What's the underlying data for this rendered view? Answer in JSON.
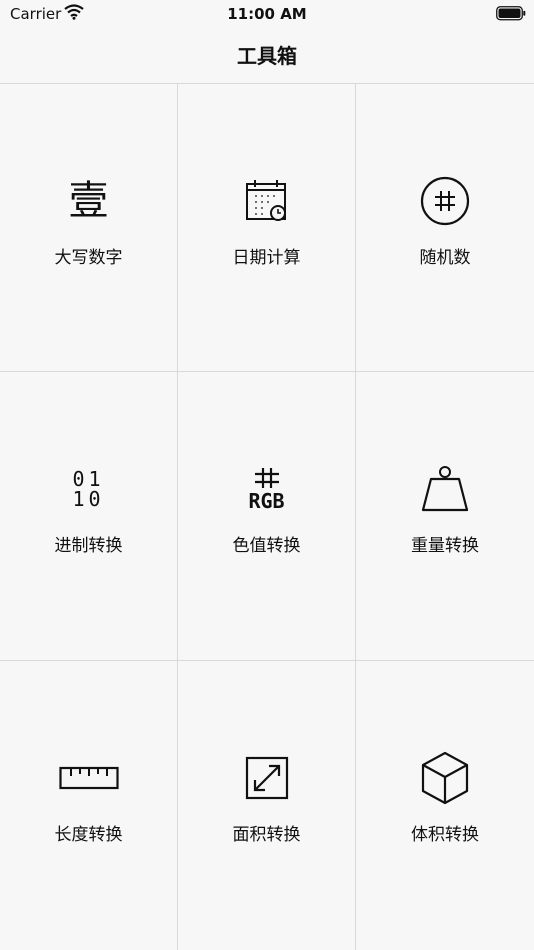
{
  "status_bar": {
    "carrier": "Carrier",
    "time": "11:00 AM"
  },
  "nav": {
    "title": "工具箱"
  },
  "tools": [
    {
      "label": "大写数字",
      "icon": "chinese-numeral-icon",
      "glyph": "壹"
    },
    {
      "label": "日期计算",
      "icon": "calendar-clock-icon"
    },
    {
      "label": "随机数",
      "icon": "hash-circle-icon"
    },
    {
      "label": "进制转换",
      "icon": "binary-icon",
      "glyph_line1": "01",
      "glyph_line2": "10"
    },
    {
      "label": "色值转换",
      "icon": "rgb-hash-icon",
      "glyph": "RGB"
    },
    {
      "label": "重量转换",
      "icon": "weight-icon"
    },
    {
      "label": "长度转换",
      "icon": "ruler-icon"
    },
    {
      "label": "面积转换",
      "icon": "area-expand-icon"
    },
    {
      "label": "体积转换",
      "icon": "cube-icon"
    }
  ]
}
